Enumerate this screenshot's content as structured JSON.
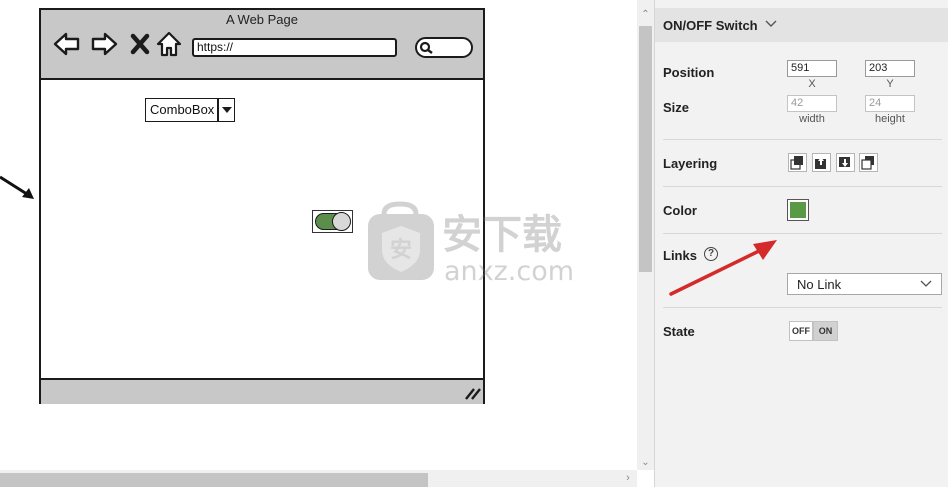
{
  "canvas": {
    "page_title": "A Web Page",
    "url": "https://",
    "combobox_label": "ComboBox",
    "toggle_state": "on",
    "watermark": {
      "cn_text": "安下载",
      "site_text": "anxz.com",
      "badge_char": "安"
    }
  },
  "panel": {
    "title": "ON/OFF Switch",
    "position": {
      "label": "Position",
      "x_value": "591",
      "y_value": "203",
      "x_caption": "X",
      "y_caption": "Y"
    },
    "size": {
      "label": "Size",
      "width_value": "42",
      "height_value": "24",
      "width_caption": "width",
      "height_caption": "height"
    },
    "layering": {
      "label": "Layering"
    },
    "color": {
      "label": "Color",
      "value": "#5b9a45"
    },
    "links": {
      "label": "Links",
      "help_glyph": "?",
      "selected": "No Link"
    },
    "state": {
      "label": "State",
      "off_label": "OFF",
      "on_label": "ON",
      "active": "ON"
    }
  },
  "colors": {
    "toggle_green": "#5b8e4a",
    "wireframe_gray": "#c8c8c8",
    "annotation_red": "#d42a2a"
  }
}
